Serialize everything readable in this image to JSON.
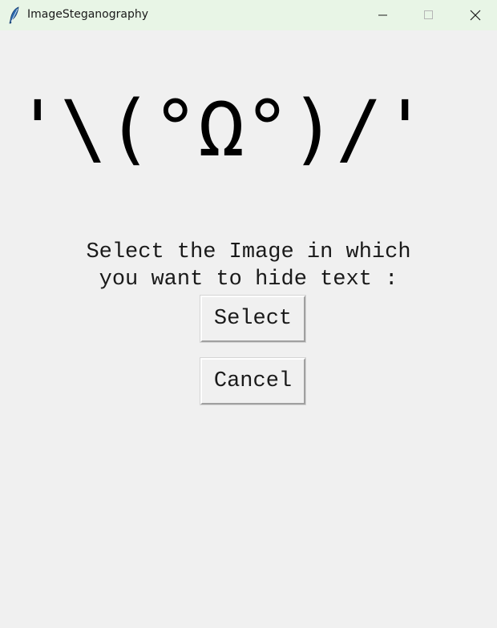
{
  "window": {
    "title": "ImageSteganography",
    "controls": {
      "minimize_icon": "minimize-icon",
      "maximize_icon": "maximize-icon",
      "close_icon": "close-icon"
    },
    "titlebar_color": "#e8f5e6",
    "background_color": "#f0f0f0"
  },
  "main": {
    "kaomoji": "'\\(°Ω°)/'",
    "prompt_line1": "Select the Image in which",
    "prompt_line2": "you want to hide text :",
    "select_label": "Select",
    "cancel_label": "Cancel"
  }
}
